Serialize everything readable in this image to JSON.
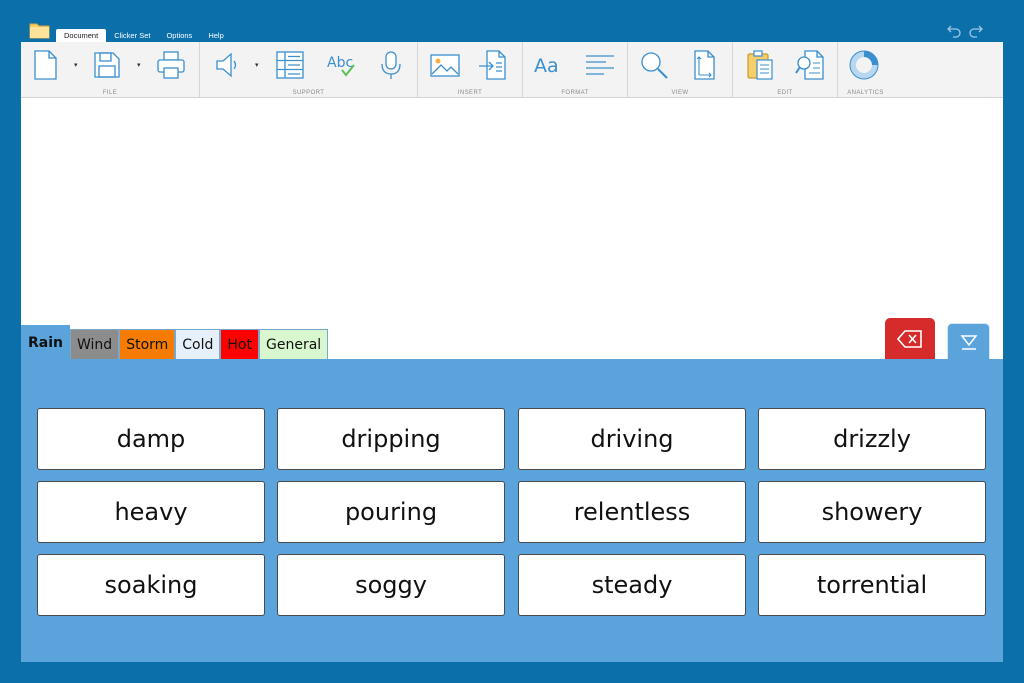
{
  "menu": {
    "tabs": [
      {
        "label": "Document",
        "active": true
      },
      {
        "label": "Clicker Set",
        "active": false
      },
      {
        "label": "Options",
        "active": false
      },
      {
        "label": "Help",
        "active": false
      }
    ]
  },
  "ribbon": {
    "groups": [
      {
        "label": "FILE"
      },
      {
        "label": "SUPPORT"
      },
      {
        "label": "INSERT"
      },
      {
        "label": "FORMAT"
      },
      {
        "label": "VIEW"
      },
      {
        "label": "EDIT"
      },
      {
        "label": "ANALYTICS"
      }
    ],
    "spell_text": "Abc",
    "format_text": "Aa"
  },
  "grid": {
    "tabs": [
      {
        "label": "Rain",
        "color": "#5aa4db"
      },
      {
        "label": "Wind",
        "color": "#8c8c8c"
      },
      {
        "label": "Storm",
        "color": "#f57c00"
      },
      {
        "label": "Cold",
        "color": "#e6f0fa"
      },
      {
        "label": "Hot",
        "color": "#ff0000"
      },
      {
        "label": "General",
        "color": "#d9f7cf"
      }
    ],
    "words": [
      [
        "damp",
        "dripping",
        "driving",
        "drizzly"
      ],
      [
        "heavy",
        "pouring",
        "relentless",
        "showery"
      ],
      [
        "soaking",
        "soggy",
        "steady",
        "torrential"
      ]
    ]
  },
  "colors": {
    "background": "#0b6fa9",
    "panel": "#5aa4db",
    "delete": "#d62b2b",
    "icon_blue": "#3a8fcf"
  }
}
